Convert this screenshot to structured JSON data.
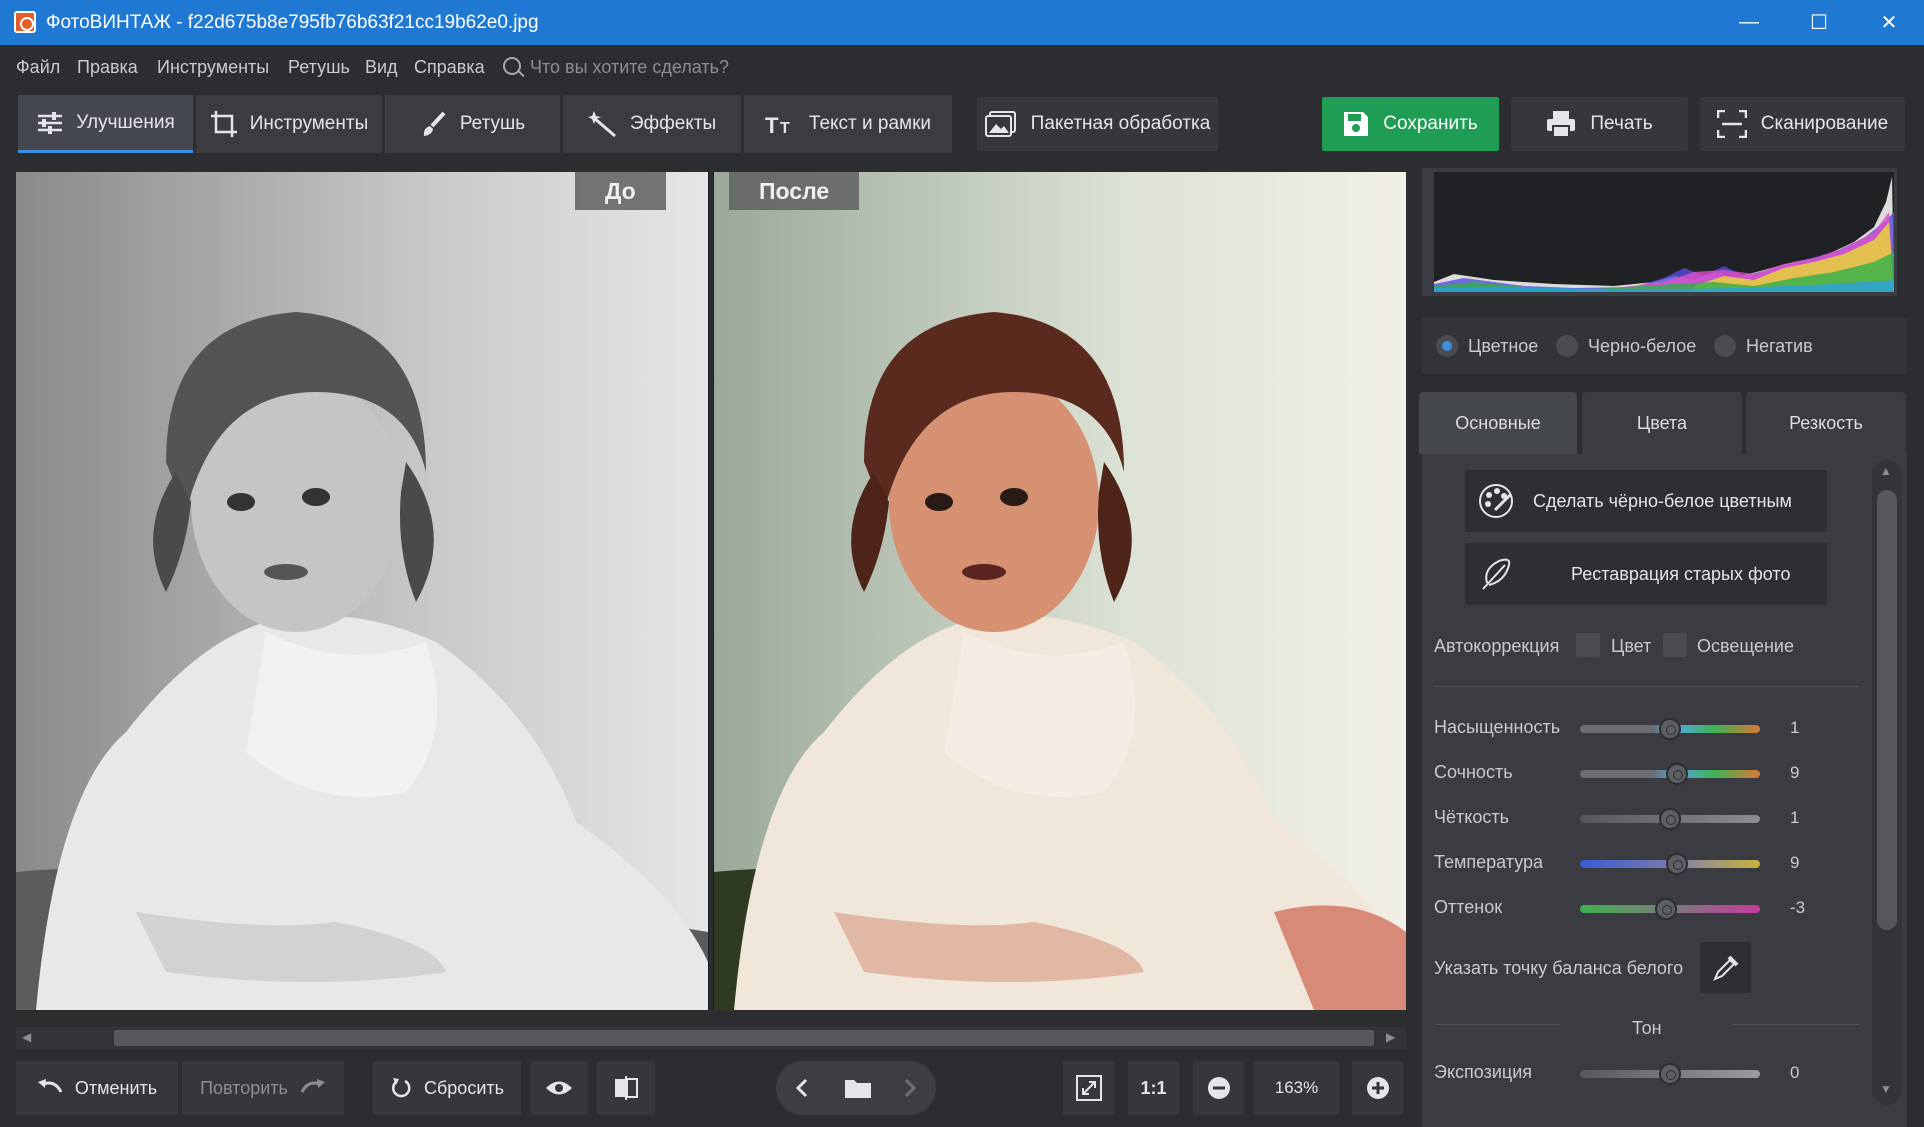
{
  "window": {
    "title": "ФотоВИНТАЖ - f22d675b8e795fb76b63f21cc19b62e0.jpg",
    "minimize": "—",
    "maximize": "☐",
    "close": "✕"
  },
  "menu": {
    "items": [
      "Файл",
      "Правка",
      "Инструменты",
      "Ретушь",
      "Вид",
      "Справка"
    ],
    "search_placeholder": "Что вы хотите сделать?"
  },
  "toolbar": {
    "tabs": [
      "Улучшения",
      "Инструменты",
      "Ретушь",
      "Эффекты",
      "Текст и рамки"
    ],
    "active_tab": "Улучшения",
    "batch_label": "Пакетная обработка",
    "save_label": "Сохранить",
    "print_label": "Печать",
    "scan_label": "Сканирование",
    "save_color": "#1f9d55"
  },
  "viewer": {
    "before_label": "До",
    "after_label": "После"
  },
  "bottom": {
    "undo_label": "Отменить",
    "redo_label": "Повторить",
    "reset_label": "Сбросить",
    "zoom_one_to_one": "1:1",
    "zoom_value": "163%"
  },
  "panel": {
    "modes": [
      "Цветное",
      "Черно-белое",
      "Негатив"
    ],
    "selected_mode": "Цветное",
    "tabs": [
      "Основные",
      "Цвета",
      "Резкость"
    ],
    "active_tab": "Основные",
    "colorize_label": "Сделать чёрно-белое цветным",
    "restore_label": "Реставрация старых фото",
    "autocorrection_label": "Автокоррекция",
    "auto_color_label": "Цвет",
    "auto_light_label": "Освещение",
    "sliders": [
      {
        "label": "Насыщенность",
        "value": "1",
        "level": 0.5
      },
      {
        "label": "Сочность",
        "value": "9",
        "level": 0.54
      },
      {
        "label": "Чёткость",
        "value": "1",
        "level": 0.5
      },
      {
        "label": "Температура",
        "value": "9",
        "level": 0.54
      },
      {
        "label": "Оттенок",
        "value": "-3",
        "level": 0.48
      }
    ],
    "white_balance_label": "Указать точку баланса белого",
    "tone_header": "Тон",
    "exposure": {
      "label": "Экспозиция",
      "value": "0",
      "level": 0.5
    }
  }
}
